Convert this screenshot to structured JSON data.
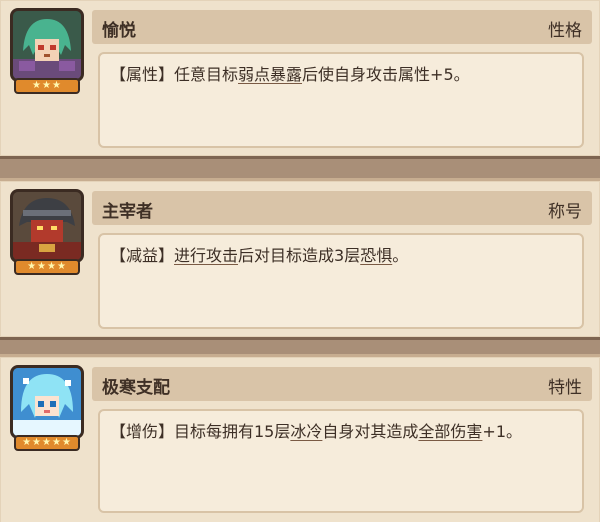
{
  "cards": [
    {
      "name": "愉悦",
      "tag": "性格",
      "stars": "★★★",
      "desc": [
        {
          "t": "【属性】任意目标",
          "u": false
        },
        {
          "t": "弱点暴露",
          "u": true
        },
        {
          "t": "后使自身攻击属性+5。",
          "u": false
        }
      ],
      "portrait_icon": "green-haired-girl-portrait-icon"
    },
    {
      "name": "主宰者",
      "tag": "称号",
      "stars": "★★★★",
      "desc": [
        {
          "t": "【减益】",
          "u": false
        },
        {
          "t": "进行攻击",
          "u": true
        },
        {
          "t": "后对目标造成3层",
          "u": false
        },
        {
          "t": "恐惧",
          "u": true
        },
        {
          "t": "。",
          "u": false
        }
      ],
      "portrait_icon": "hooded-warrior-portrait-icon"
    },
    {
      "name": "极寒支配",
      "tag": "特性",
      "stars": "★★★★★",
      "desc": [
        {
          "t": "【增伤】目标每拥有15层",
          "u": false
        },
        {
          "t": "冰冷",
          "u": true
        },
        {
          "t": "自身对其造成",
          "u": false
        },
        {
          "t": "全部伤害",
          "u": true
        },
        {
          "t": "+1。",
          "u": false
        }
      ],
      "portrait_icon": "ice-haired-girl-portrait-icon"
    }
  ],
  "colors": {
    "panel": "#efe2cc",
    "header": "#d9c4a8",
    "text": "#3f3026",
    "star_badge": "#e08a2c"
  }
}
